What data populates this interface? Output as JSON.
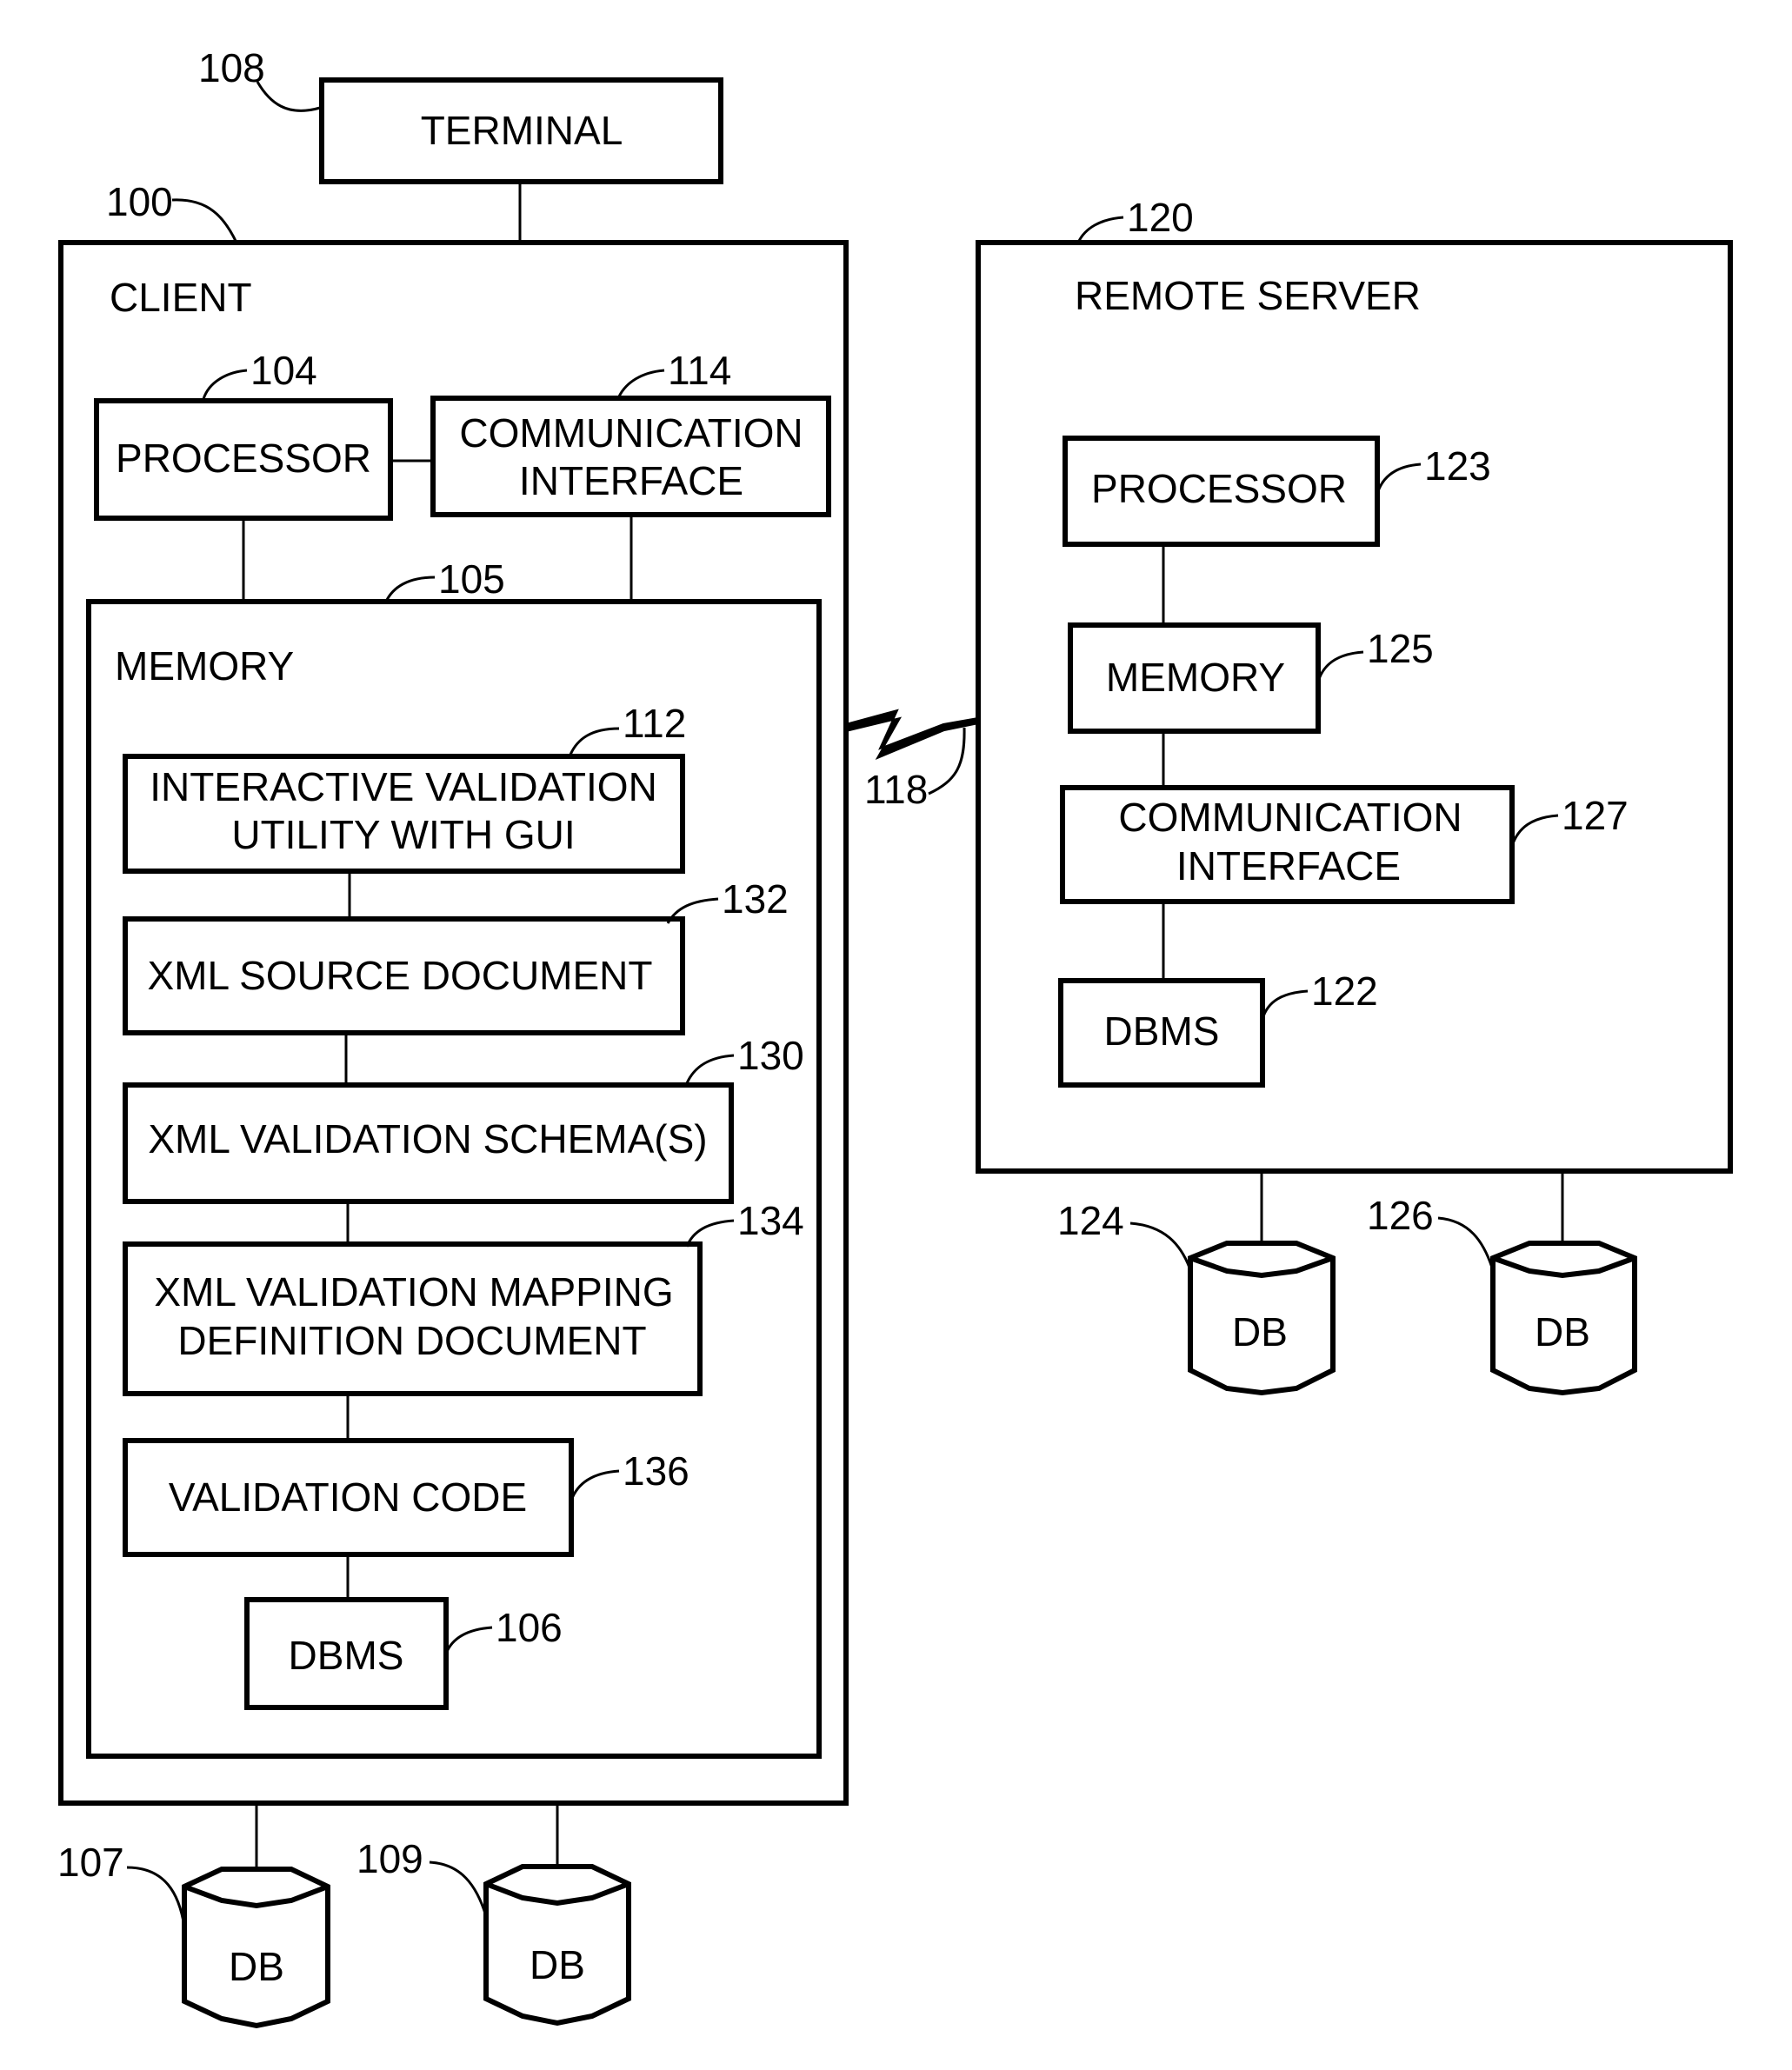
{
  "figure": {
    "terminal": {
      "label": "TERMINAL",
      "ref": "108"
    },
    "client": {
      "label": "CLIENT",
      "ref": "100",
      "processor": {
        "label": "PROCESSOR",
        "ref": "104"
      },
      "comm_interface": {
        "line1": "COMMUNICATION",
        "line2": "INTERFACE",
        "ref": "114"
      },
      "memory": {
        "label": "MEMORY",
        "ref": "105",
        "interactive_utility": {
          "line1": "INTERACTIVE VALIDATION",
          "line2": "UTILITY WITH GUI",
          "ref": "112"
        },
        "xml_source": {
          "label": "XML SOURCE DOCUMENT",
          "ref": "132"
        },
        "xml_schema": {
          "label": "XML VALIDATION SCHEMA(S)",
          "ref": "130"
        },
        "mapping_doc": {
          "line1": "XML VALIDATION MAPPING",
          "line2": "DEFINITION DOCUMENT",
          "ref": "134"
        },
        "validation_code": {
          "label": "VALIDATION CODE",
          "ref": "136"
        },
        "dbms": {
          "label": "DBMS",
          "ref": "106"
        }
      },
      "databases": [
        {
          "label": "DB",
          "ref": "107"
        },
        {
          "label": "DB",
          "ref": "109"
        }
      ]
    },
    "network_link": {
      "ref": "118"
    },
    "remote_server": {
      "label": "REMOTE SERVER",
      "ref": "120",
      "processor": {
        "label": "PROCESSOR",
        "ref": "123"
      },
      "memory": {
        "label": "MEMORY",
        "ref": "125"
      },
      "comm_interface": {
        "line1": "COMMUNICATION",
        "line2": "INTERFACE",
        "ref": "127"
      },
      "dbms": {
        "label": "DBMS",
        "ref": "122"
      },
      "databases": [
        {
          "label": "DB",
          "ref": "124"
        },
        {
          "label": "DB",
          "ref": "126"
        }
      ]
    }
  }
}
